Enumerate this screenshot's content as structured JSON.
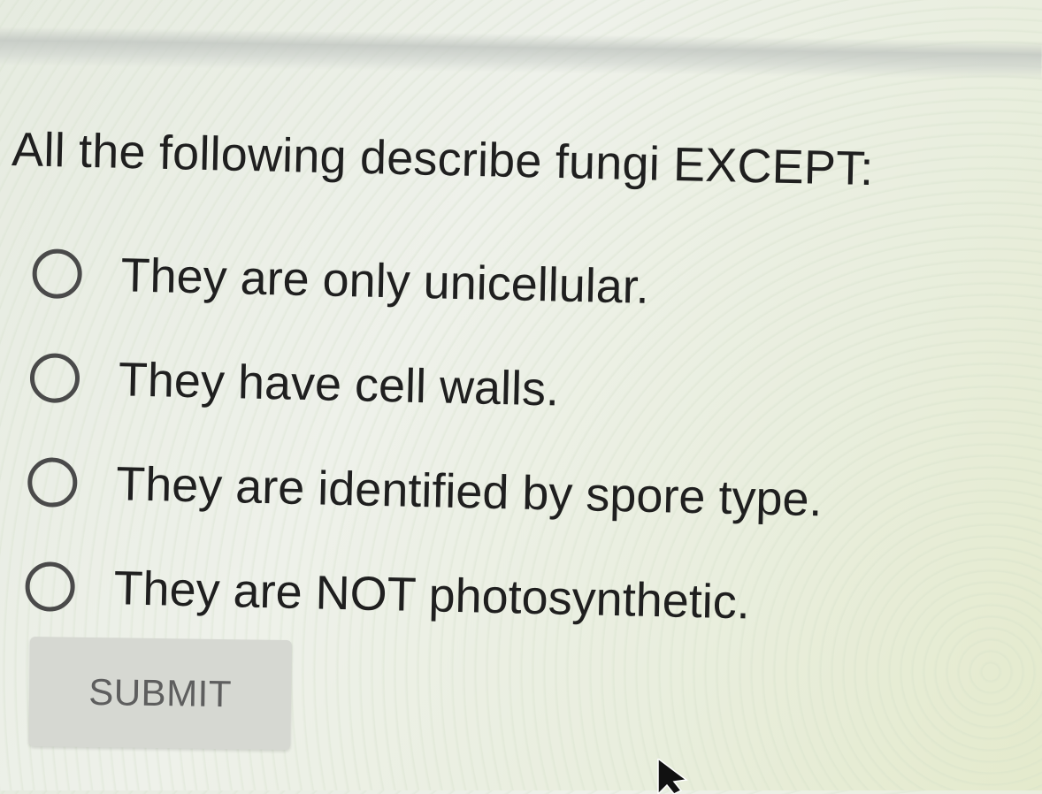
{
  "question": {
    "text": "All the following describe fungi EXCEPT:"
  },
  "options": [
    {
      "label": "They are only unicellular.",
      "selected": false
    },
    {
      "label": "They have cell walls.",
      "selected": false
    },
    {
      "label": "They are identified by spore type.",
      "selected": false
    },
    {
      "label": "They are NOT photosynthetic.",
      "selected": false
    }
  ],
  "submit": {
    "label": "SUBMIT",
    "enabled": false
  },
  "icons": {
    "cursor": "mouse-pointer-icon"
  },
  "colors": {
    "text": "#1f1f1f",
    "radio_border": "#4a4a4a",
    "submit_bg": "#d6d8d2",
    "submit_text": "#5e5e5e"
  }
}
